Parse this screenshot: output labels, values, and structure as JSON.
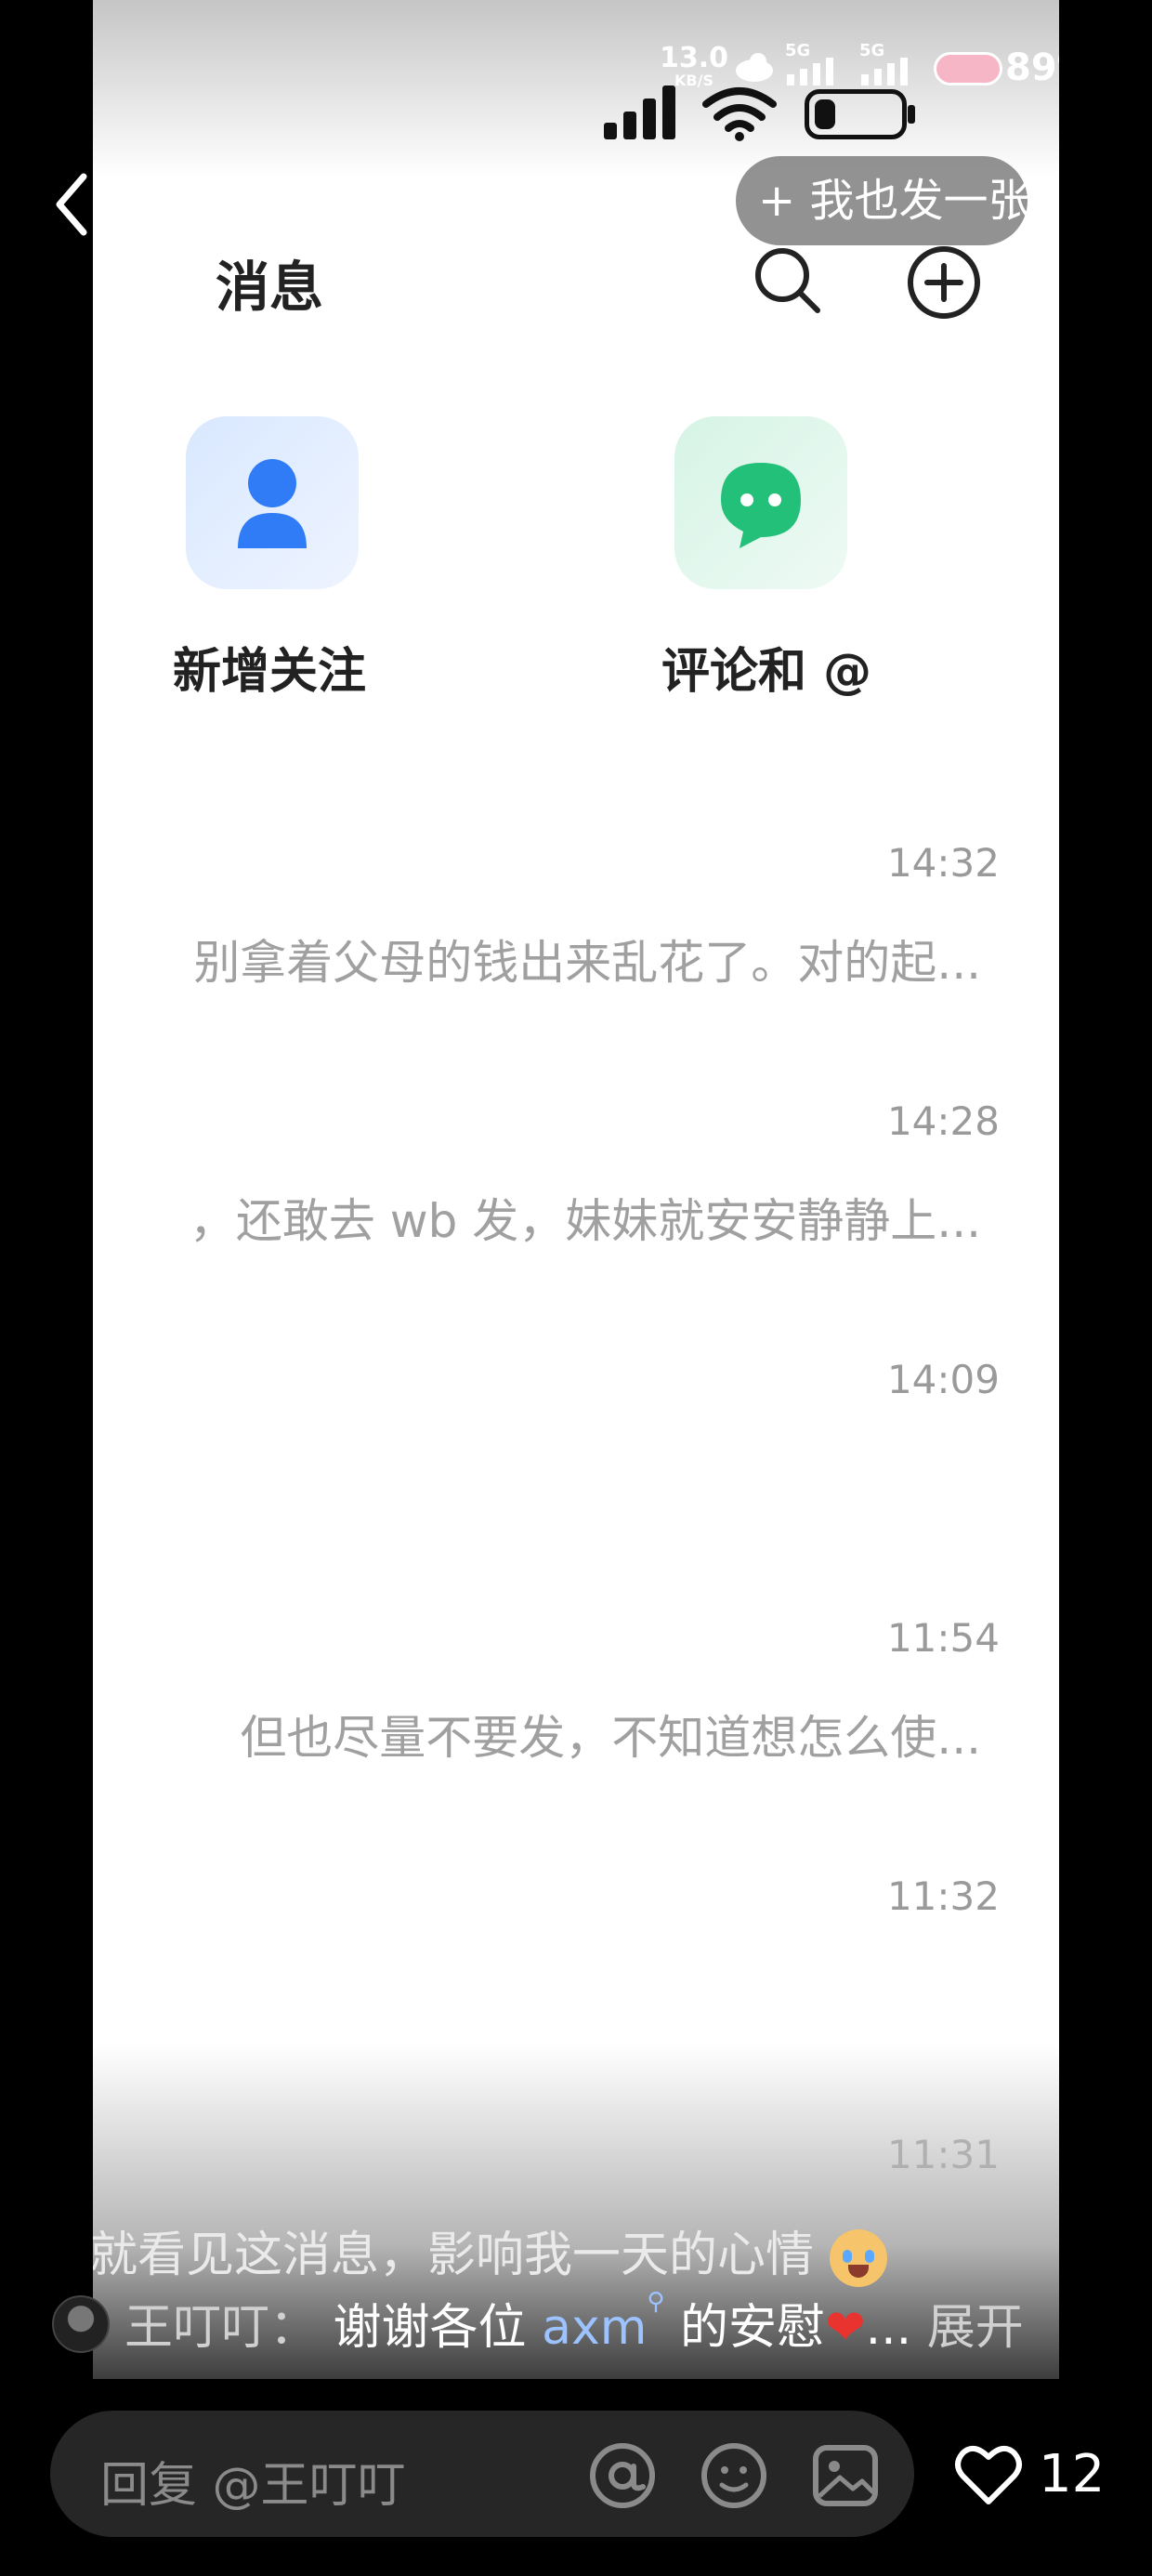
{
  "status_bar": {
    "speed": "13.0",
    "speed_unit": "KB/S",
    "net1": "5G",
    "net2": "5G",
    "battery": "89%"
  },
  "post_button": "+ 我也发一张",
  "header": {
    "title": "消息"
  },
  "shortcuts": [
    {
      "label": "新增关注"
    },
    {
      "label": "评论和 @"
    }
  ],
  "messages": [
    {
      "time": "14:32",
      "preview": "别拿着父母的钱出来乱花了。对的起..."
    },
    {
      "time": "14:28",
      "preview": "，还敢去 wb 发，妹妹就安安静静上..."
    },
    {
      "time": "14:09",
      "preview": ""
    },
    {
      "time": "11:54",
      "preview": "但也尽量不要发，不知道想怎么使..."
    },
    {
      "time": "11:32",
      "preview": ""
    },
    {
      "time": "11:31",
      "preview": "就看见这消息，影响我一天的心情"
    }
  ],
  "comment": {
    "author": "王叮叮：",
    "text_before": "谢谢各位",
    "mention": "axm",
    "text_after": "的安慰",
    "ellipsis": "...",
    "expand": "展开"
  },
  "reply_bar": {
    "placeholder": "回复 @王叮叮",
    "like_count": "12"
  }
}
